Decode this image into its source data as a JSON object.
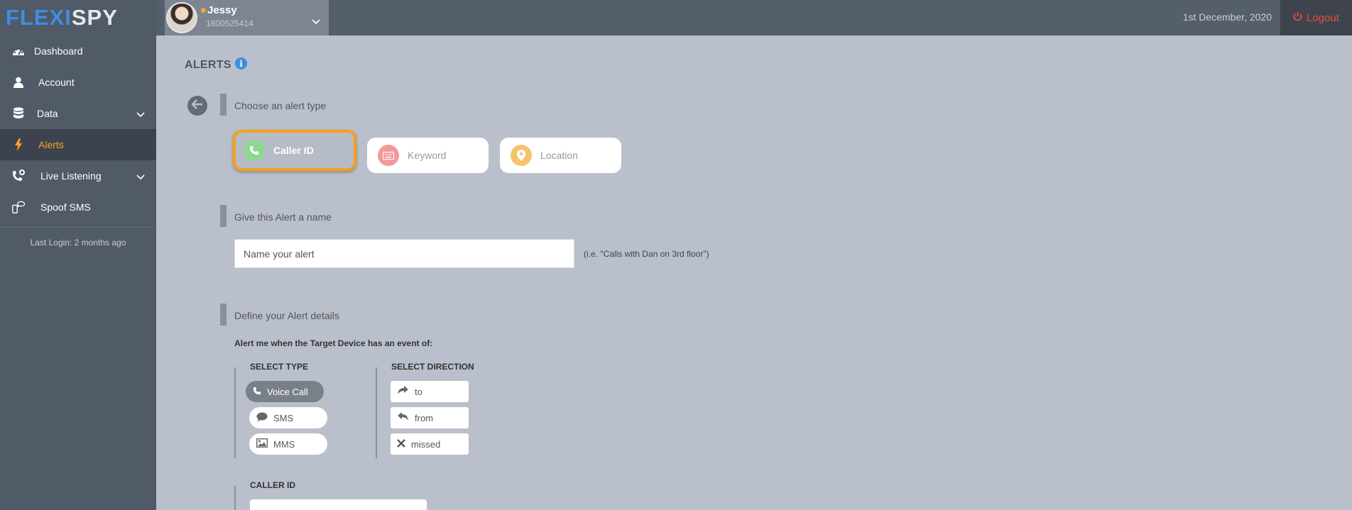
{
  "app": {
    "logo_part1": "FLEXI",
    "logo_part2": "SPY"
  },
  "user": {
    "name": "Jessy",
    "phone": "1800525414",
    "status_color": "#f5a623"
  },
  "topbar": {
    "date": "1st December, 2020",
    "logout_label": "Logout"
  },
  "sidebar": {
    "items": [
      {
        "label": "Dashboard",
        "icon": "dashboard-icon"
      },
      {
        "label": "Account",
        "icon": "user-icon"
      },
      {
        "label": "Data",
        "icon": "database-icon",
        "expandable": true
      },
      {
        "label": "Alerts",
        "icon": "bolt-icon",
        "active": true
      },
      {
        "label": "Live Listening",
        "icon": "phone-settings-icon",
        "expandable": true
      },
      {
        "label": "Spoof SMS",
        "icon": "spoof-sms-icon"
      }
    ],
    "last_login": "Last Login: 2 months ago"
  },
  "main": {
    "title": "ALERTS",
    "section1_label": "Choose an alert type",
    "alert_types": [
      {
        "label": "Caller ID",
        "icon": "phone-icon",
        "color": "#8fd88f",
        "selected": true
      },
      {
        "label": "Keyword",
        "icon": "keyboard-icon",
        "color": "#f29a9a",
        "selected": false
      },
      {
        "label": "Location",
        "icon": "map-pin-icon",
        "color": "#f7c26e",
        "selected": false
      }
    ],
    "section2_label": "Give this Alert a name",
    "name_placeholder": "Name your alert",
    "name_hint": "(i.e. \"Calls with Dan on 3rd floor\")",
    "section3_label": "Define your Alert details",
    "alert_me_text": "Alert me when the Target Device has an event of:",
    "select_type_heading": "SELECT TYPE",
    "types": [
      {
        "label": "Voice Call",
        "icon": "phone-icon",
        "active": true
      },
      {
        "label": "SMS",
        "icon": "chat-bubble-icon",
        "active": false
      },
      {
        "label": "MMS",
        "icon": "image-icon",
        "active": false
      }
    ],
    "select_direction_heading": "SELECT DIRECTION",
    "directions": [
      {
        "label": "to",
        "icon": "forward-arrow-icon"
      },
      {
        "label": "from",
        "icon": "reply-arrow-icon"
      },
      {
        "label": "missed",
        "icon": "x-icon"
      }
    ],
    "caller_id_heading": "CALLER ID"
  },
  "colors": {
    "accent": "#f5a623",
    "brand_blue": "#3d8ee0",
    "logout_red": "#e74c3c"
  }
}
